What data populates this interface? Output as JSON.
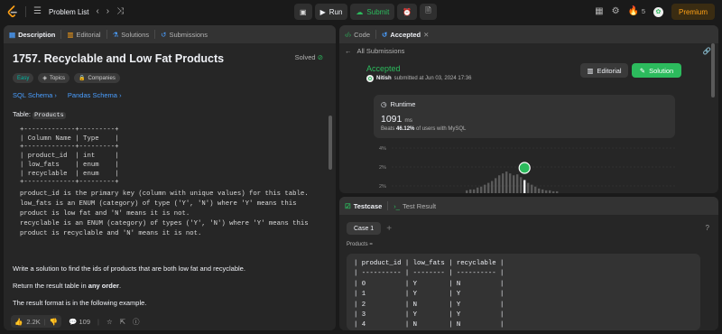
{
  "topbar": {
    "problem_list": "Problem List",
    "run_label": "Run",
    "submit_label": "Submit",
    "streak": "5",
    "premium_label": "Premium"
  },
  "left": {
    "tabs": [
      "Description",
      "Editorial",
      "Solutions",
      "Submissions"
    ],
    "title": "1757. Recyclable and Low Fat Products",
    "solved": "Solved",
    "chips": [
      "Easy",
      "Topics",
      "Companies"
    ],
    "schema_links": [
      "SQL Schema",
      "Pandas Schema"
    ],
    "table_label": "Table:",
    "table_name": "Products",
    "schema_table": "+-------------+---------+\n| Column Name | Type    |\n+-------------+---------+\n| product_id  | int     |\n| low_fats    | enum    |\n| recyclable  | enum    |\n+-------------+---------+",
    "schema_desc": "product_id is the primary key (column with unique values) for this table.\nlow_fats is an ENUM (category) of type ('Y', 'N') where 'Y' means this\nproduct is low fat and 'N' means it is not.\nrecyclable is an ENUM (category) of types ('Y', 'N') where 'Y' means this\nproduct is recyclable and 'N' means it is not.",
    "para1": "Write a solution to find the ids of products that are both low fat and recyclable.",
    "para2_prefix": "Return the result table in ",
    "para2_bold": "any order",
    "para2_suffix": ".",
    "para3": "The result format is in the following example.",
    "likes": "2.2K",
    "comments": "109"
  },
  "rtop": {
    "tabs": [
      "Code",
      "Accepted"
    ],
    "all_submissions": "All Submissions",
    "status": "Accepted",
    "author": "Nitish",
    "submitted_text": "submitted at Jun 03, 2024 17:36",
    "editorial_btn": "Editorial",
    "solution_btn": "Solution",
    "runtime_label": "Runtime",
    "runtime_value": "1091",
    "runtime_unit": "ms",
    "beats_prefix": "Beats",
    "beats_value": "46.12%",
    "beats_suffix": "of users with MySQL"
  },
  "chart_data": {
    "type": "bar",
    "y_tick_labels": [
      "4%",
      "2%",
      "2%"
    ],
    "values": [
      0.3,
      0.4,
      0.4,
      0.6,
      0.7,
      0.9,
      1.1,
      1.3,
      1.6,
      1.9,
      2.1,
      2.3,
      2.1,
      1.9,
      2.0,
      1.7,
      1.4,
      1.1,
      0.9,
      0.7,
      0.5,
      0.4,
      0.3,
      0.3,
      0.2,
      0.2
    ],
    "highlight_index": 16,
    "ylim": [
      0,
      5
    ]
  },
  "rbot": {
    "tabs": [
      "Testcase",
      "Test Result"
    ],
    "case_label": "Case 1",
    "products_label": "Products =",
    "products_table": "| product_id | low_fats | recyclable |\n| ---------- | -------- | ---------- |\n| 0          | Y        | N          |\n| 1          | Y        | Y          |\n| 2          | N        | Y          |\n| 3          | Y        | Y          |\n| 4          | N        | N          |"
  }
}
